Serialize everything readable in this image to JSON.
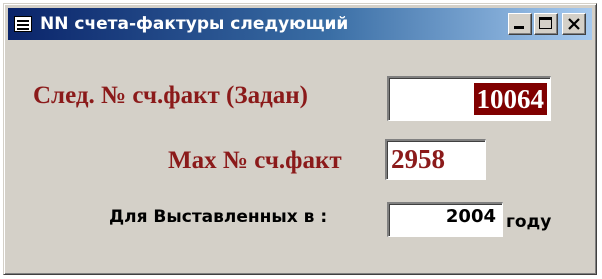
{
  "window": {
    "title": "NN счета-фактуры следующий",
    "controls": {
      "minimize": "minimize",
      "maximize": "maximize",
      "close": "close"
    }
  },
  "form": {
    "next_invoice": {
      "label": "След. № сч.факт (Задан)",
      "value": "10064"
    },
    "max_invoice": {
      "label": "Max № сч.факт",
      "value": "2958"
    },
    "year": {
      "label": "Для Выставленных в :",
      "value": "2004",
      "suffix": "году"
    }
  },
  "colors": {
    "titlebar_start": "#0a246a",
    "titlebar_end": "#a6caf0",
    "label_red": "#8b1a1a",
    "selection": "#800000",
    "window_face": "#d4d0c8"
  }
}
